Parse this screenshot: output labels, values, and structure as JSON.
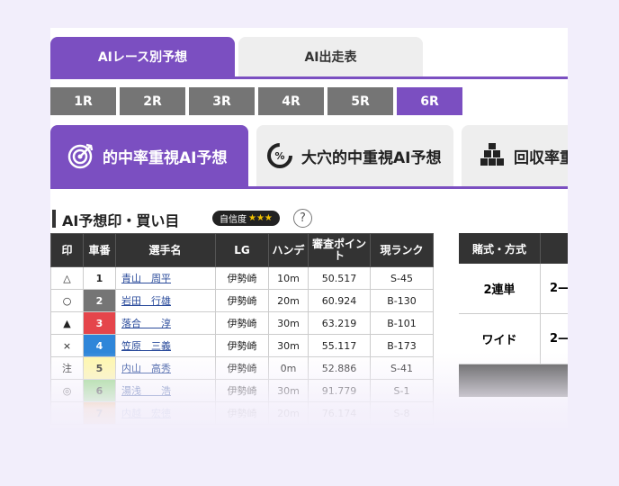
{
  "top_tabs": {
    "race_prediction": "AIレース別予想",
    "race_table": "AI出走表"
  },
  "races": [
    "1R",
    "2R",
    "3R",
    "4R",
    "5R",
    "6R"
  ],
  "active_race": "6R",
  "prediction_tabs": {
    "hit": "的中率重視AI予想",
    "upset": "大穴的中重視AI予想",
    "return": "回収率重"
  },
  "section": {
    "title": "AI予想印・買い目",
    "confidence_label": "自信度",
    "confidence_stars": "★★★",
    "help": "?"
  },
  "table": {
    "headers": {
      "mark": "印",
      "car": "車番",
      "name": "選手名",
      "lg": "LG",
      "handicap": "ハンデ",
      "points": "審査ポイント",
      "rank": "現ランク"
    },
    "rows": [
      {
        "mark": "△",
        "car": "1",
        "car_bg": "#ffffff",
        "car_fg": "#222222",
        "name": "青山　周平",
        "lg": "伊勢崎",
        "handicap": "10m",
        "points": "50.517",
        "rank": "S-45"
      },
      {
        "mark": "○",
        "car": "2",
        "car_bg": "#757575",
        "car_fg": "#ffffff",
        "name": "岩田　行雄",
        "lg": "伊勢崎",
        "handicap": "20m",
        "points": "60.924",
        "rank": "B-130"
      },
      {
        "mark": "▲",
        "car": "3",
        "car_bg": "#e5454b",
        "car_fg": "#ffffff",
        "name": "落合　　淳",
        "lg": "伊勢崎",
        "handicap": "30m",
        "points": "63.219",
        "rank": "B-101"
      },
      {
        "mark": "×",
        "car": "4",
        "car_bg": "#2f86d9",
        "car_fg": "#ffffff",
        "name": "笠原　三義",
        "lg": "伊勢崎",
        "handicap": "30m",
        "points": "55.117",
        "rank": "B-173"
      },
      {
        "mark": "注",
        "car": "5",
        "car_bg": "#fff7a8",
        "car_fg": "#222222",
        "name": "内山　高秀",
        "lg": "伊勢崎",
        "handicap": "0m",
        "points": "52.886",
        "rank": "S-41"
      },
      {
        "mark": "◎",
        "car": "6",
        "car_bg": "#8fd67e",
        "car_fg": "#222222",
        "name": "湯浅　　浩",
        "lg": "伊勢崎",
        "handicap": "30m",
        "points": "91.779",
        "rank": "S-1"
      },
      {
        "mark": "",
        "car": "7",
        "car_bg": "#f0a040",
        "car_fg": "#222222",
        "name": "内越　宏徳",
        "lg": "伊勢崎",
        "handicap": "20m",
        "points": "76.174",
        "rank": "S-8"
      }
    ]
  },
  "bets": {
    "header": "賭式・方式",
    "rows": [
      {
        "type": "2連単",
        "value": "2—"
      },
      {
        "type": "ワイド",
        "value": "2—"
      }
    ]
  },
  "colors": {
    "accent": "#7b4fc1",
    "tab_inactive": "#eeeeee",
    "race_inactive": "#757575",
    "header_dark": "#333333"
  }
}
